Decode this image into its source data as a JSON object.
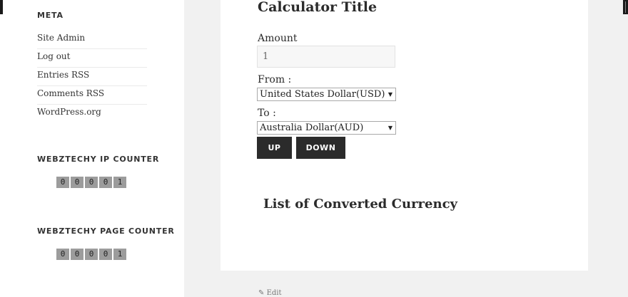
{
  "sidebar": {
    "meta": {
      "title": "META",
      "links": [
        "Site Admin",
        "Log out",
        "Entries RSS",
        "Comments RSS",
        "WordPress.org"
      ]
    },
    "ip_counter": {
      "title": "WEBZTECHY IP COUNTER",
      "digits": [
        "0",
        "0",
        "0",
        "0",
        "1"
      ]
    },
    "page_counter": {
      "title": "WEBZTECHY PAGE COUNTER",
      "digits": [
        "0",
        "0",
        "0",
        "0",
        "1"
      ]
    }
  },
  "calculator": {
    "title": "Calculator Title",
    "amount_label": "Amount",
    "amount_value": "1",
    "from_label": "From :",
    "from_value": "United States Dollar(USD)",
    "to_label": "To :",
    "to_value": "Australia Dollar(AUD)",
    "up_label": "UP",
    "down_label": "DOWN"
  },
  "list_title": "List of Converted Currency",
  "edit_label": "Edit",
  "icons": {
    "dropdown": "dropdown-arrow-icon",
    "edit": "pencil-icon"
  }
}
